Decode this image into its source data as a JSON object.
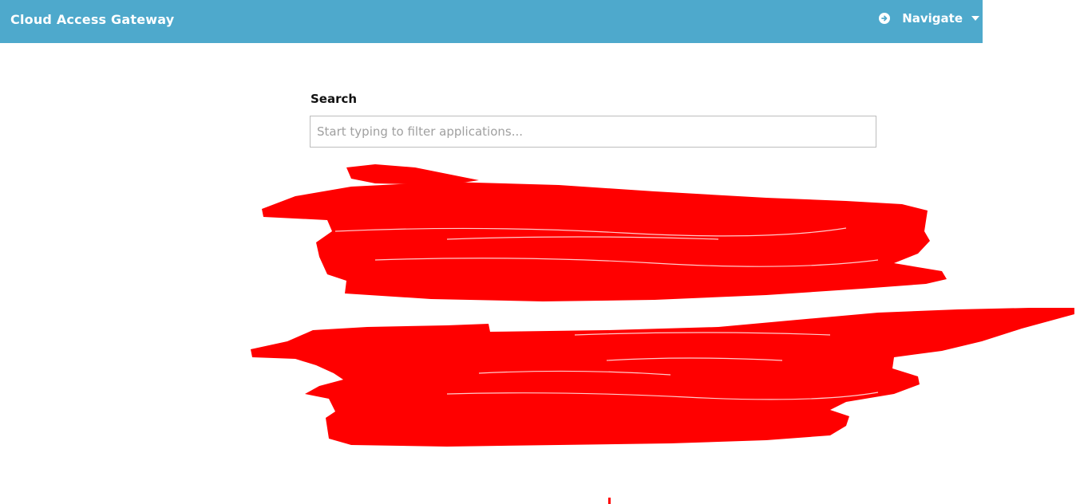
{
  "header": {
    "title": "Cloud Access Gateway",
    "nav_label": "Navigate",
    "nav_icon": "arrow-circle-right-icon",
    "caret_icon": "caret-down-icon",
    "background_color": "#4ea9cc"
  },
  "search": {
    "label": "Search",
    "placeholder": "Start typing to filter applications...",
    "value": ""
  },
  "redaction_color": "#ff0000"
}
